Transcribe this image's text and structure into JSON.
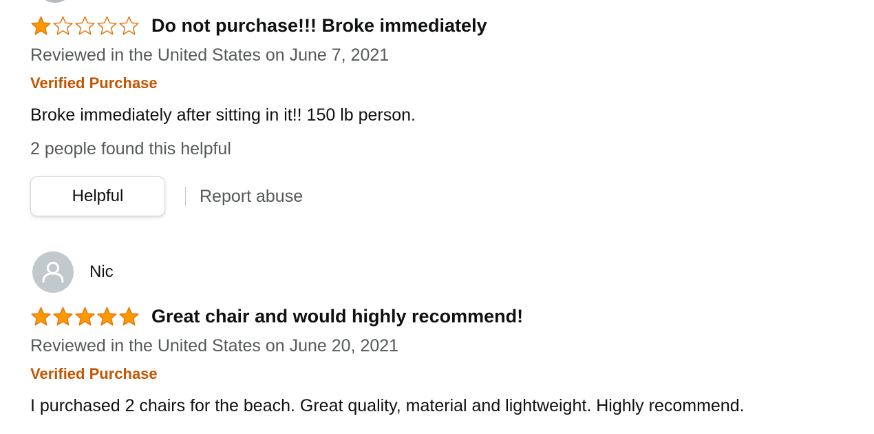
{
  "reviews": [
    {
      "rating": 1,
      "max_rating": 5,
      "title": "Do not purchase!!! Broke immediately",
      "meta": "Reviewed in the United States on June 7, 2021",
      "verified": "Verified Purchase",
      "body": "Broke immediately after sitting in it!! 150 lb person.",
      "helpful_count": "2 people found this helpful",
      "helpful_button": "Helpful",
      "report_link": "Report abuse"
    },
    {
      "reviewer": "Nic",
      "rating": 5,
      "max_rating": 5,
      "title": "Great chair and would highly recommend!",
      "meta": "Reviewed in the United States on June 20, 2021",
      "verified": "Verified Purchase",
      "body": "I purchased 2 chairs for the beach. Great quality, material and lightweight. Highly recommend."
    }
  ],
  "colors": {
    "star_fill": "#ff9900",
    "star_outline": "#e47911",
    "verified": "#c45500",
    "meta_text": "#565959"
  },
  "icons": {
    "star": "star-icon",
    "avatar": "user-avatar-icon"
  }
}
